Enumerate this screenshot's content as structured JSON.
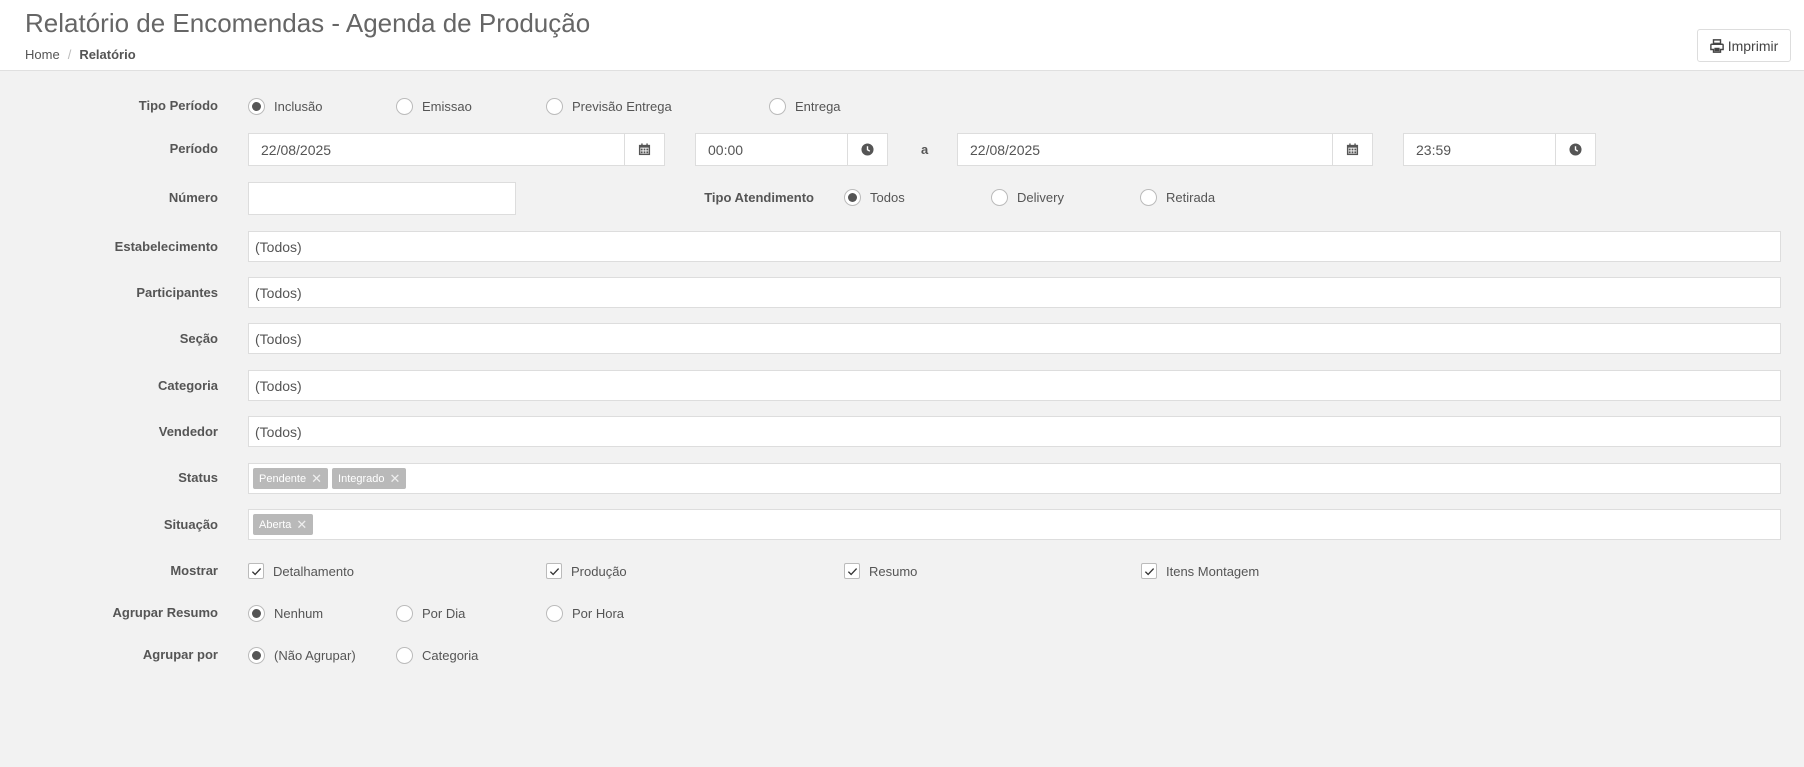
{
  "header": {
    "title": "Relatório de Encomendas - Agenda de Produção",
    "breadcrumb": {
      "home": "Home",
      "separator": "/",
      "current": "Relatório"
    },
    "print_label": "Imprimir"
  },
  "form": {
    "tipo_periodo": {
      "label": "Tipo Período",
      "options": [
        "Inclusão",
        "Emissao",
        "Previsão Entrega",
        "Entrega"
      ],
      "selected": "Inclusão"
    },
    "periodo": {
      "label": "Período",
      "start_date": "22/08/2025",
      "start_time": "00:00",
      "separator": "a",
      "end_date": "22/08/2025",
      "end_time": "23:59"
    },
    "numero": {
      "label": "Número",
      "value": ""
    },
    "tipo_atendimento": {
      "label": "Tipo Atendimento",
      "options": [
        "Todos",
        "Delivery",
        "Retirada"
      ],
      "selected": "Todos"
    },
    "estabelecimento": {
      "label": "Estabelecimento",
      "value": "(Todos)"
    },
    "participantes": {
      "label": "Participantes",
      "value": "(Todos)"
    },
    "secao": {
      "label": "Seção",
      "value": "(Todos)"
    },
    "categoria": {
      "label": "Categoria",
      "value": "(Todos)"
    },
    "vendedor": {
      "label": "Vendedor",
      "value": "(Todos)"
    },
    "status": {
      "label": "Status",
      "tags": [
        "Pendente",
        "Integrado"
      ]
    },
    "situacao": {
      "label": "Situação",
      "tags": [
        "Aberta"
      ]
    },
    "mostrar": {
      "label": "Mostrar",
      "options": [
        "Detalhamento",
        "Produção",
        "Resumo",
        "Itens Montagem"
      ],
      "checked": [
        true,
        true,
        true,
        true
      ]
    },
    "agrupar_resumo": {
      "label": "Agrupar Resumo",
      "options": [
        "Nenhum",
        "Por Dia",
        "Por Hora"
      ],
      "selected": "Nenhum"
    },
    "agrupar_por": {
      "label": "Agrupar por",
      "options": [
        "(Não Agrupar)",
        "Categoria"
      ],
      "selected": "(Não Agrupar)"
    }
  }
}
